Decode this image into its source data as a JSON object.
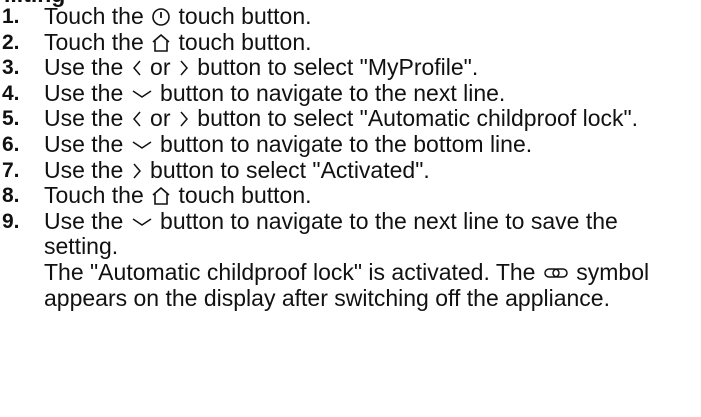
{
  "heading": "...ting",
  "steps": [
    {
      "num": "1.",
      "before": "Touch the ",
      "icon": "power-icon",
      "after": " touch button."
    },
    {
      "num": "2.",
      "before": "Touch the ",
      "icon": "home-icon",
      "after": " touch button."
    },
    {
      "num": "3.",
      "before": "Use the ",
      "icon": "chevron-left-icon",
      "mid": " or ",
      "icon2": "chevron-right-icon",
      "after": " button to select \"MyProfile\"."
    },
    {
      "num": "4.",
      "before": "Use the ",
      "icon": "chevron-down-icon",
      "after": " button to navigate to the next line."
    },
    {
      "num": "5.",
      "before": "Use the ",
      "icon": "chevron-left-icon",
      "mid": " or ",
      "icon2": "chevron-right-icon",
      "after": " button to select \"Automatic childproof lock\"."
    },
    {
      "num": "6.",
      "before": "Use the ",
      "icon": "chevron-down-icon",
      "after": " button to navigate to the bottom line."
    },
    {
      "num": "7.",
      "before": "Use the ",
      "icon": "chevron-right-icon",
      "after": " button to select \"Activated\"."
    },
    {
      "num": "8.",
      "before": "Touch the ",
      "icon": "home-icon",
      "after": " touch button."
    },
    {
      "num": "9.",
      "before": "Use the ",
      "icon": "chevron-down-icon",
      "after": " button to navigate to the next line to save the setting."
    }
  ],
  "result": {
    "before": "The \"Automatic childproof lock\" is activated. The ",
    "icon": "childproof-lock-icon",
    "after": " symbol appears on the display after switching off the appliance."
  }
}
